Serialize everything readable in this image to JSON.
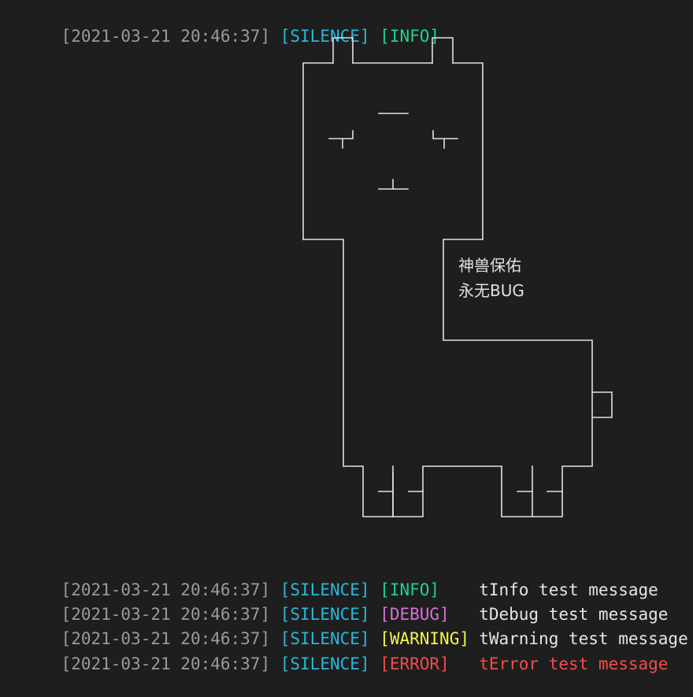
{
  "header_line": {
    "timestamp": "[2021-03-21 20:46:37]",
    "logger": "[SILENCE]",
    "level": "[INFO]"
  },
  "ascii_art": {
    "blessing_line1": "神兽保佑",
    "blessing_line2": "永无BUG"
  },
  "log_lines": [
    {
      "timestamp": "[2021-03-21 20:46:37]",
      "logger": "[SILENCE]",
      "level": "[INFO]",
      "message": "tInfo test message",
      "level_color": "#23d18b",
      "message_color": "#e5e5e5"
    },
    {
      "timestamp": "[2021-03-21 20:46:37]",
      "logger": "[SILENCE]",
      "level": "[DEBUG]",
      "message": "tDebug test message",
      "level_color": "#d670d6",
      "message_color": "#e5e5e5"
    },
    {
      "timestamp": "[2021-03-21 20:46:37]",
      "logger": "[SILENCE]",
      "level": "[WARNING]",
      "message": "tWarning test message",
      "level_color": "#f5f543",
      "message_color": "#e5e5e5"
    },
    {
      "timestamp": "[2021-03-21 20:46:37]",
      "logger": "[SILENCE]",
      "level": "[ERROR]",
      "message": "tError test message",
      "level_color": "#f14c4c",
      "message_color": "#f14c4c"
    }
  ],
  "colors": {
    "background": "#1e1e1e",
    "timestamp": "#9a9a9a",
    "logger": "#29b8db",
    "art_lines": "#e0e0e0"
  }
}
